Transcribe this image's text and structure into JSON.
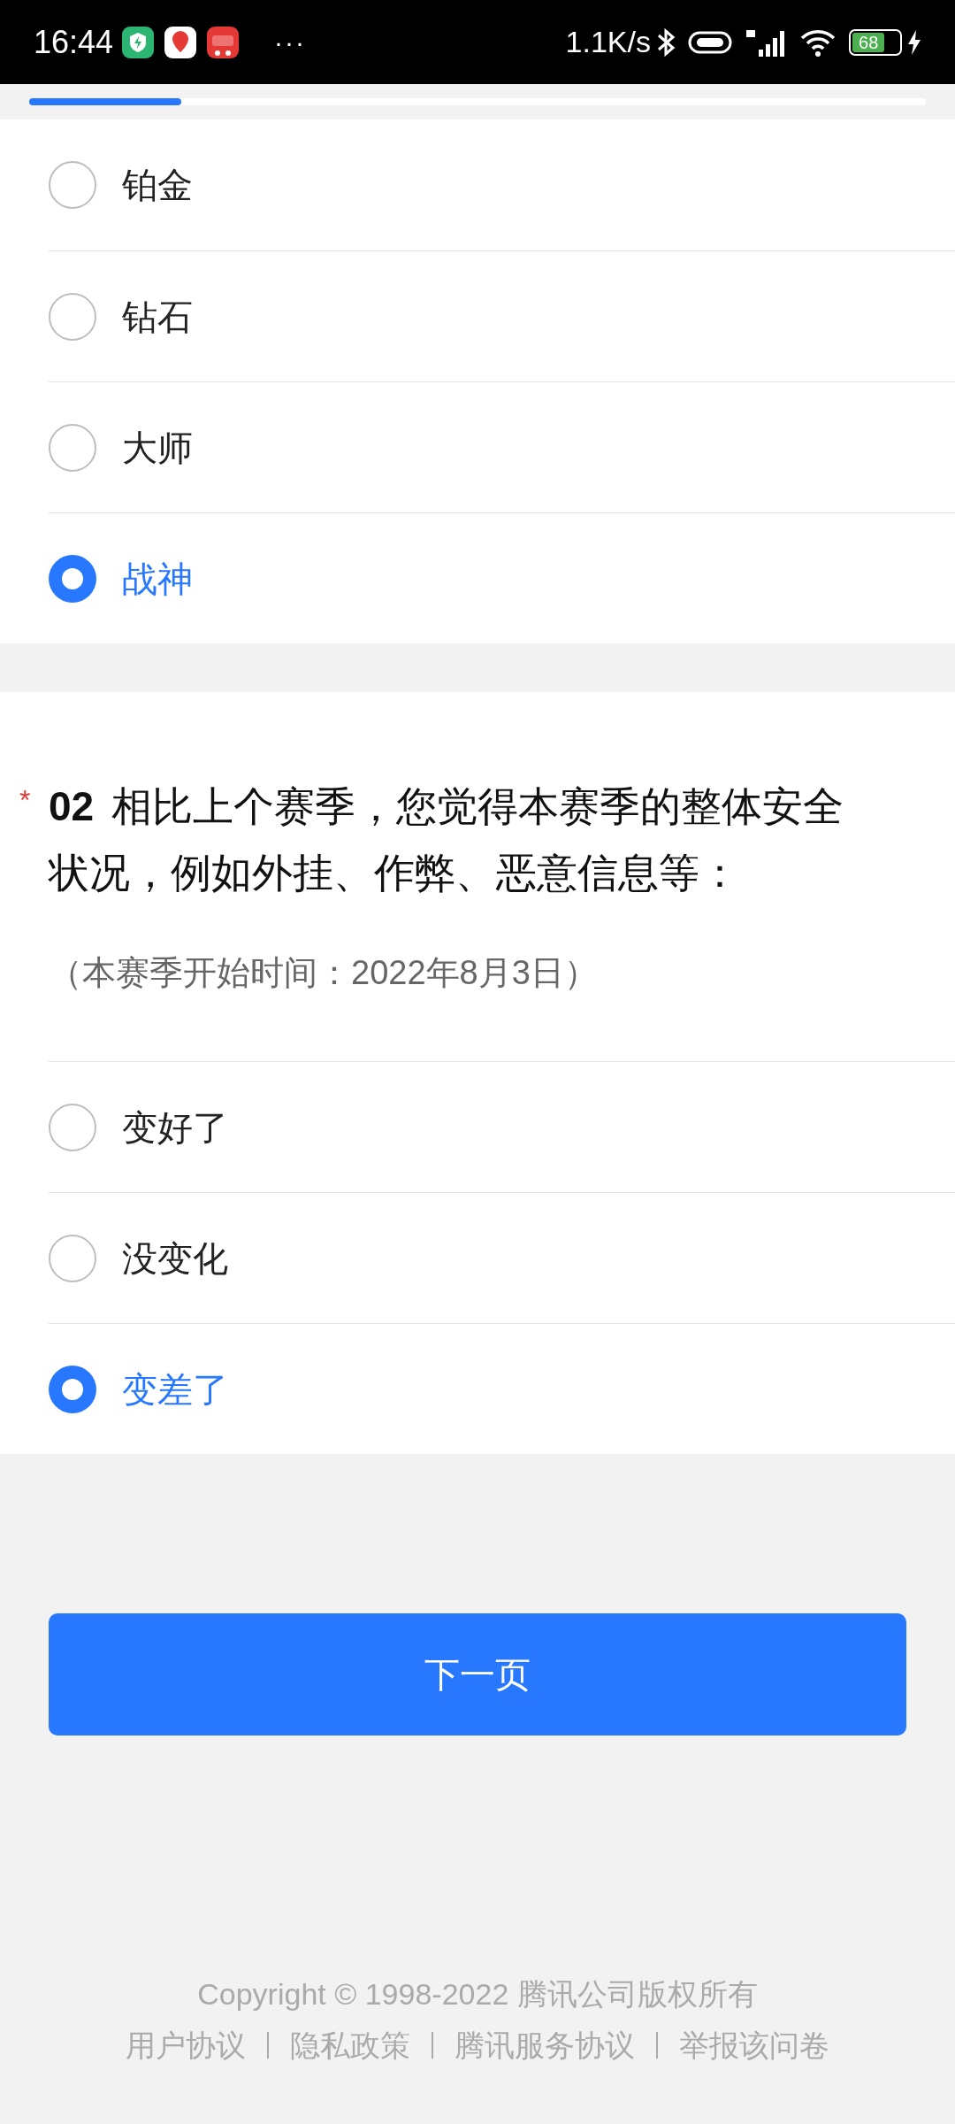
{
  "status_bar": {
    "time": "16:44",
    "net_speed": "1.1K/s",
    "battery": "68",
    "notification_more": "···"
  },
  "progress": {
    "level": 0.17
  },
  "questions": [
    {
      "options": [
        {
          "label": "铂金",
          "selected": false
        },
        {
          "label": "钻石",
          "selected": false
        },
        {
          "label": "大师",
          "selected": false
        },
        {
          "label": "战神",
          "selected": true
        }
      ]
    },
    {
      "required_mark": "*",
      "number": "02",
      "title": "相比上个赛季，您觉得本赛季的整体安全状况，例如外挂、作弊、恶意信息等：",
      "note": "（本赛季开始时间：2022年8月3日）",
      "options": [
        {
          "label": "变好了",
          "selected": false
        },
        {
          "label": "没变化",
          "selected": false
        },
        {
          "label": "变差了",
          "selected": true
        }
      ]
    }
  ],
  "next_button": "下一页",
  "footer": {
    "copyright": "Copyright © 1998-2022 腾讯公司版权所有",
    "links": [
      "用户协议",
      "隐私政策",
      "腾讯服务协议",
      "举报该问卷"
    ]
  }
}
